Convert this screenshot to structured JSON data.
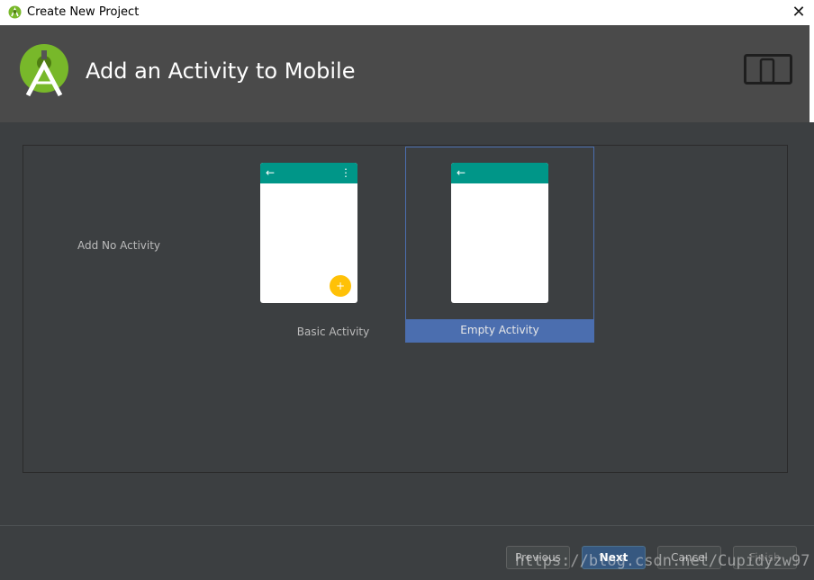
{
  "window": {
    "title": "Create New Project",
    "close_glyph": "✕",
    "app_icon": "android-studio-icon"
  },
  "header": {
    "heading": "Add an Activity to Mobile",
    "logo_icon": "android-studio-logo",
    "device_icon": "tablet-phone-icon",
    "background": "#4a4a4a"
  },
  "gallery": {
    "tiles": [
      {
        "label": "Add No Activity",
        "selected": false
      },
      {
        "label": "Basic Activity",
        "selected": false,
        "preview": {
          "appbar_color": "#009688",
          "back_glyph": "←",
          "menu_glyph": "⋮",
          "fab_glyph": "+",
          "fab_color": "#ffc107"
        }
      },
      {
        "label": "Empty Activity",
        "selected": true,
        "preview": {
          "appbar_color": "#009688",
          "back_glyph": "←"
        }
      }
    ],
    "selection_color": "#4b6eaf"
  },
  "footer": {
    "previous_label": "Previous",
    "next_label": "Next",
    "cancel_label": "Cancel",
    "finish_label": "Finish",
    "finish_enabled": false
  },
  "watermark": "https://blog.csdn.net/Cupidyzw97"
}
